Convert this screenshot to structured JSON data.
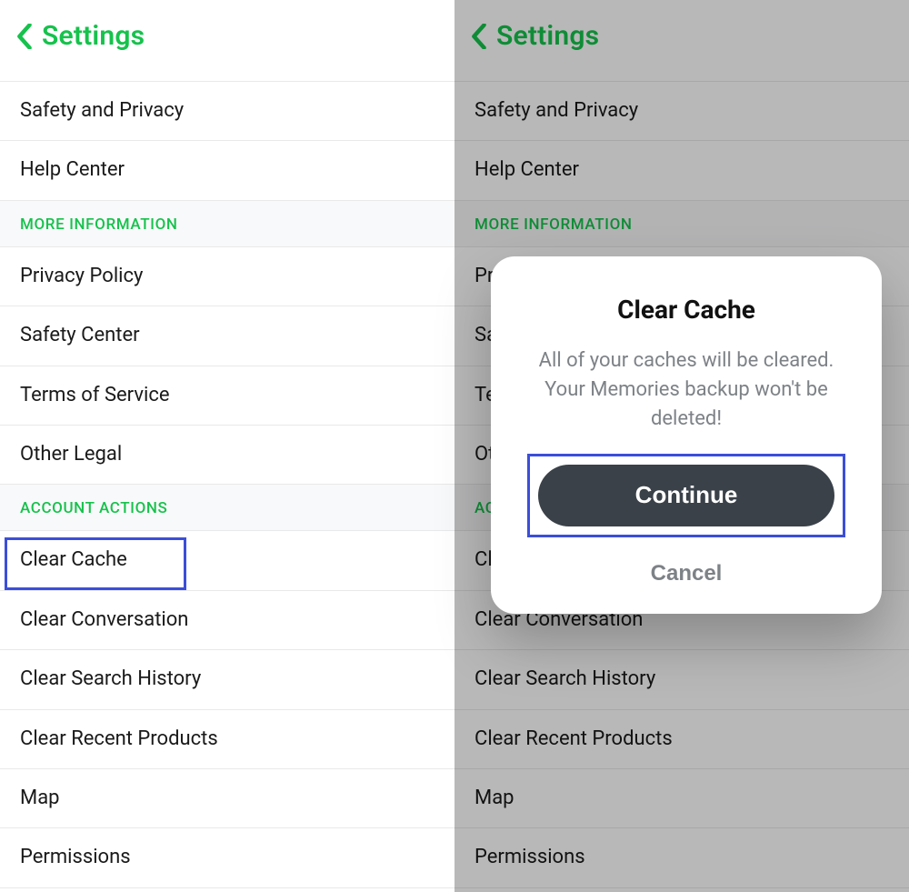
{
  "header": {
    "title": "Settings"
  },
  "items_top": [
    {
      "label": "Safety and Privacy"
    },
    {
      "label": "Help Center"
    }
  ],
  "section_more": "MORE INFORMATION",
  "items_more": [
    {
      "label": "Privacy Policy"
    },
    {
      "label": "Safety Center"
    },
    {
      "label": "Terms of Service"
    },
    {
      "label": "Other Legal"
    }
  ],
  "section_account": "ACCOUNT ACTIONS",
  "items_account": [
    {
      "label": "Clear Cache"
    },
    {
      "label": "Clear Conversation"
    },
    {
      "label": "Clear Search History"
    },
    {
      "label": "Clear Recent Products"
    },
    {
      "label": "Map"
    },
    {
      "label": "Permissions"
    }
  ],
  "modal": {
    "title": "Clear Cache",
    "body": "All of your caches will be cleared. Your Memories backup won't be deleted!",
    "continue": "Continue",
    "cancel": "Cancel"
  }
}
